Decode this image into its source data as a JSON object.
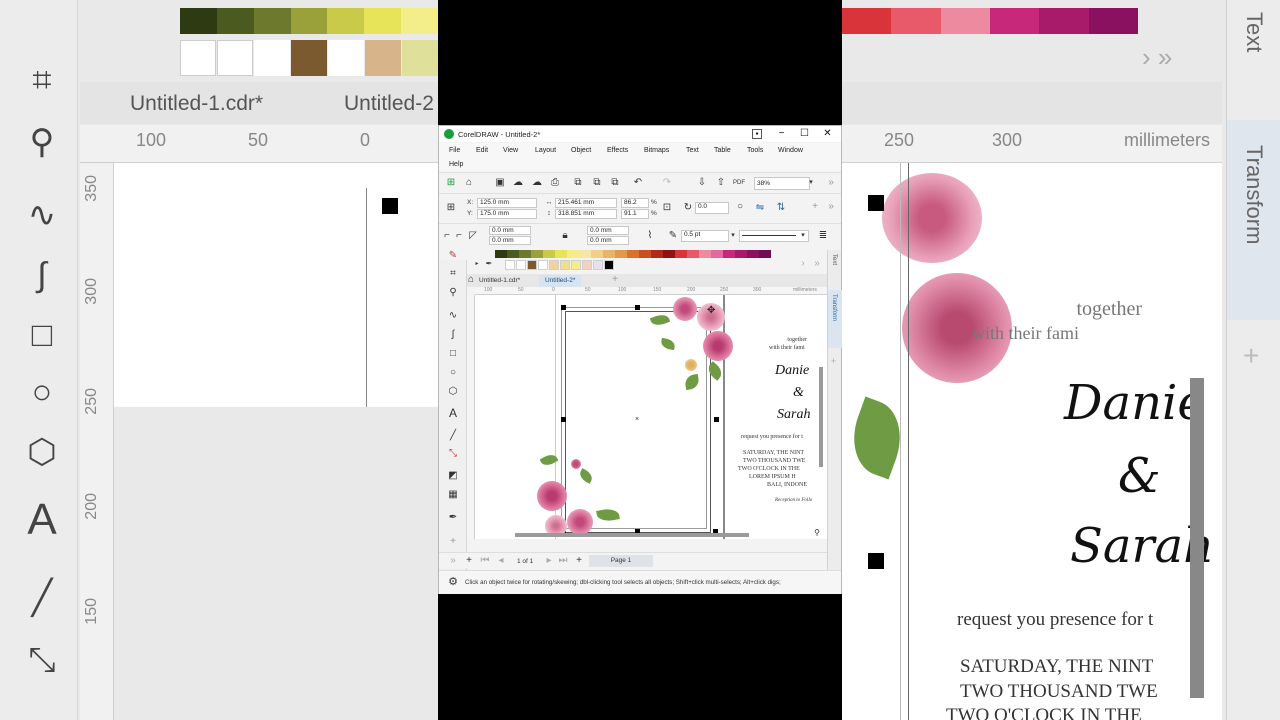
{
  "app": {
    "title": "CorelDRAW - Untitled-2*",
    "window_controls": [
      "−",
      "☐",
      "✕"
    ]
  },
  "menu": [
    "File",
    "Edit",
    "View",
    "Layout",
    "Object",
    "Effects",
    "Bitmaps",
    "Text",
    "Table",
    "Tools",
    "Window",
    "Help"
  ],
  "toolbar": {
    "zoom": "38%"
  },
  "property_bar": {
    "x_label": "X:",
    "x_value": "125.0 mm",
    "y_label": "Y:",
    "y_value": "175.0 mm",
    "width_value": "215.461 mm",
    "height_value": "318.851 mm",
    "scale_w": "86.2",
    "scale_h": "91.1",
    "percent": "%",
    "rotation": "0.0",
    "corner_top": "0.0 mm",
    "corner_bottom": "0.0 mm",
    "corner_top2": "0.0 mm",
    "corner_bottom2": "0.0 mm",
    "outline_width": "0.5 pt"
  },
  "palette_colors": [
    "#2e3a12",
    "#4b5a1e",
    "#6d7a2e",
    "#9aa03a",
    "#c9c94a",
    "#e8e45a",
    "#f3ee8a",
    "#f5e7a8",
    "#f1d08a",
    "#e9b36a",
    "#e09a4a",
    "#d9722e",
    "#c9501f",
    "#b02a1a",
    "#8e1414",
    "#d8343a",
    "#e85a6a",
    "#ee8aa0",
    "#e36aa0",
    "#c8287a",
    "#a81a6a",
    "#8a1060",
    "#6e0c54"
  ],
  "palette2_colors": [
    "#ffffff",
    "#ffffff",
    "#7a5a2e",
    "#ffffff",
    "#f1d49a",
    "#f0e08a",
    "#f3ee8a",
    "#f5d0c0",
    "#e8e0ea",
    "#000000"
  ],
  "tabs": [
    {
      "label": "Untitled-1.cdr*"
    },
    {
      "label": "Untitled-2*"
    }
  ],
  "ruler": {
    "ticks": [
      "100",
      "50",
      "0",
      "50",
      "100",
      "150",
      "200",
      "250",
      "300"
    ],
    "unit": "millimeters"
  },
  "dock": {
    "text_label": "Text",
    "transform_label": "Transform"
  },
  "document": {
    "together": "together",
    "with_family": "with their fami",
    "name1": "Danie",
    "amp": "&",
    "name2": "Sarah",
    "request": "request you presence for t",
    "line1": "SATURDAY, THE NINT",
    "line2": "TWO THOUSAND TWE",
    "line3": "TWO O'CLOCK IN THE",
    "line4": "LOREM IPSUM H",
    "line5": "BALI, INDONE",
    "reception": "Reception to Follo"
  },
  "page_nav": {
    "count": "1 of 1",
    "page_label": "Page 1"
  },
  "status": {
    "hint": "Click an object twice for rotating/skewing; dbl-clicking tool selects all objects; Shift+click multi-selects; Alt+click digs;"
  },
  "background": {
    "left_tab1": "Untitled-1.cdr*",
    "left_tab2": "Untitled-2",
    "ruler_left": [
      "100",
      "50",
      "0"
    ],
    "ruler_right": [
      "250",
      "300"
    ],
    "ruler_unit": "millimeters",
    "vruler": [
      "350",
      "300",
      "250",
      "200",
      "150"
    ],
    "together": "together",
    "with_family": "with their fami",
    "name1": "Danie",
    "amp": "&",
    "name2": "Sarah",
    "request": "request you presence for t",
    "line1": "SATURDAY, THE NINT",
    "line2": "TWO THOUSAND TWE",
    "line3": "TWO O'CLOCK IN THE",
    "text_label": "Text",
    "transform_label": "Transform"
  }
}
